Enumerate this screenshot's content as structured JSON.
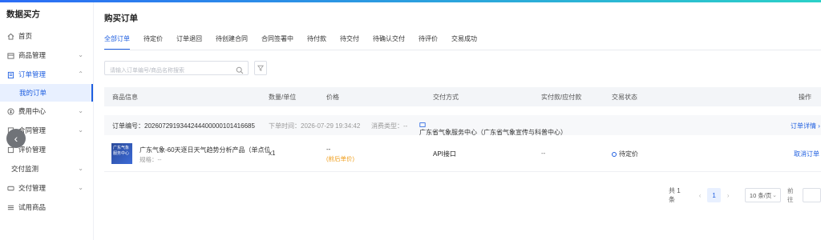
{
  "app": {
    "title": "数据买方"
  },
  "sidebar": {
    "items": [
      {
        "label": "首页",
        "icon": "home-icon",
        "chevron": ""
      },
      {
        "label": "商品管理",
        "icon": "box-icon",
        "chevron": "⌄"
      },
      {
        "label": "订单管理",
        "icon": "clipboard-icon",
        "chevron": "⌃"
      },
      {
        "label": "我的订单",
        "sub": true
      },
      {
        "label": "费用中心",
        "icon": "coin-icon",
        "chevron": "⌄"
      },
      {
        "label": "合同管理",
        "icon": "contract-icon",
        "chevron": "⌄"
      },
      {
        "label": "评价管理",
        "icon": "star-icon",
        "chevron": ""
      },
      {
        "label": "交付监测",
        "icon": "",
        "chevron": "⌄"
      },
      {
        "label": "交付管理",
        "icon": "truck-icon",
        "chevron": "⌄"
      },
      {
        "label": "试用商品",
        "icon": "list-icon",
        "chevron": ""
      }
    ]
  },
  "page": {
    "title": "购买订单"
  },
  "tabs": [
    "全部订单",
    "待定价",
    "订单退回",
    "待创建合同",
    "合同签署中",
    "待付款",
    "待交付",
    "待确认交付",
    "待评价",
    "交易成功"
  ],
  "search": {
    "placeholder": "请输入订单编号/商品名称搜索"
  },
  "table": {
    "headers": {
      "product": "商品信息",
      "qty": "数量/单位",
      "price": "价格",
      "delivery": "交付方式",
      "paid": "实付款/应付款",
      "status": "交易状态",
      "action": "操作"
    }
  },
  "order": {
    "number_label": "订单编号：202607291934424440000010141668​5",
    "order_time": "下单时间：2026-07-29 19:34:42",
    "consume_type": "消费类型：--",
    "seller": "广东省气象服务中心（广东省气象宣传与科普中心）",
    "detail_link": "订单详情 ›",
    "product_name": "广东气象-60天逐日天气趋势分析产品（单点位)",
    "product_spec": "规格：--",
    "thumb_text": "广东气象 服务中心",
    "qty": "x1",
    "price": "--",
    "price_note": "(前后单价)",
    "delivery": "API接口",
    "paid": "--",
    "status": "待定价",
    "action": "取消订单"
  },
  "pagination": {
    "total": "共 1 条",
    "prev": "‹",
    "current": "1",
    "next": "›",
    "page_size": "10 条/页",
    "goto": "前往"
  },
  "colors": {
    "primary": "#1f5fe0",
    "warning": "#f0a020"
  }
}
